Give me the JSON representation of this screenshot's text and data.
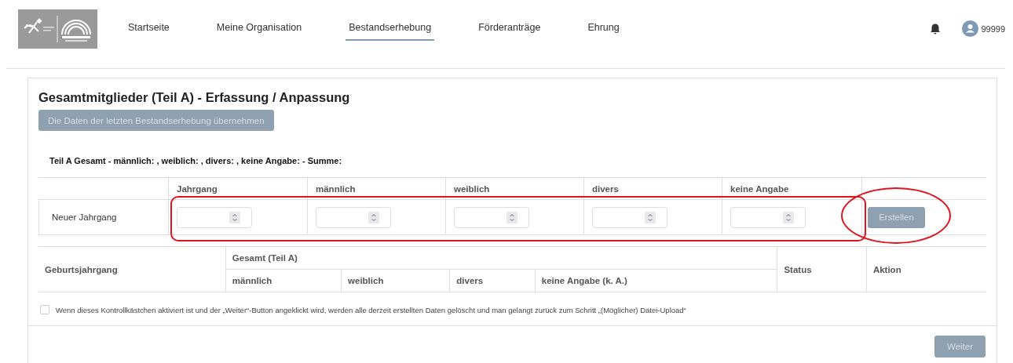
{
  "header": {
    "nav_items": [
      {
        "label": "Startseite",
        "selected": false
      },
      {
        "label": "Meine Organisation",
        "selected": false
      },
      {
        "label": "Bestandserhebung",
        "selected": true
      },
      {
        "label": "Förderanträge",
        "selected": false
      },
      {
        "label": "Ehrung",
        "selected": false
      }
    ],
    "user_id": "99999"
  },
  "form": {
    "title": "Gesamtmitglieder (Teil A) - Erfassung / Anpassung",
    "copy_button": {
      "label": "Die Daten der letzten Bestandserhebung übernehmen",
      "disabled": true
    },
    "summary": "Teil A Gesamt - männlich: , weiblich: , divers: , keine Angabe: - Summe:",
    "entry_table": {
      "columns": [
        "Jahrgang",
        "männlich",
        "weiblich",
        "divers",
        "keine Angabe"
      ],
      "row_label": "Neuer Jahrgang",
      "inputs_highlighted": true,
      "create_button": {
        "label": "Erstellen",
        "disabled": true,
        "circled": true
      }
    },
    "list_table": {
      "first_column": "Geburtsjahrgang",
      "group": "Gesamt (Teil A)",
      "group_columns": [
        "männlich",
        "weiblich",
        "divers",
        "keine Angabe (k. A.)"
      ],
      "last_columns": [
        "Status",
        "Aktion"
      ]
    },
    "reset_checkbox": {
      "label": "Wenn dieses Kontrollkästchen aktiviert ist und der „Weiter“-Button angeklickt wird, werden alle derzeit erstellten Daten gelöscht und man gelangt zurück zum Schritt „(Möglicher) Datei-Upload“",
      "checked": false
    },
    "next_button": {
      "label": "Weiter",
      "disabled": true
    }
  }
}
